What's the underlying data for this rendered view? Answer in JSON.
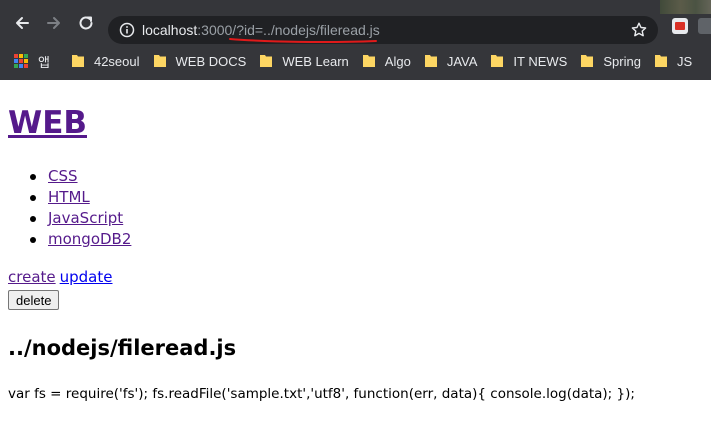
{
  "browser": {
    "url": {
      "host": "localhost",
      "rest": ":3000/?id=../nodejs/fileread.js"
    },
    "icons": {
      "back": "arrow-left-icon",
      "forward": "arrow-right-icon",
      "reload": "reload-icon",
      "site_info": "info-icon",
      "bookmark": "star-icon"
    },
    "bookmarks": [
      {
        "label": "앱",
        "icon": "apps-grid-icon"
      },
      {
        "label": "42seoul",
        "icon": "folder-icon"
      },
      {
        "label": "WEB DOCS",
        "icon": "folder-icon"
      },
      {
        "label": "WEB Learn",
        "icon": "folder-icon"
      },
      {
        "label": "Algo",
        "icon": "folder-icon"
      },
      {
        "label": "JAVA",
        "icon": "folder-icon"
      },
      {
        "label": "IT NEWS",
        "icon": "folder-icon"
      },
      {
        "label": "Spring",
        "icon": "folder-icon"
      },
      {
        "label": "JS",
        "icon": "folder-icon"
      }
    ]
  },
  "page": {
    "title": "WEB",
    "topics": [
      "CSS",
      "HTML",
      "JavaScript",
      "mongoDB2"
    ],
    "controls": {
      "create": "create",
      "update": "update",
      "delete": "delete"
    },
    "content": {
      "heading": "../nodejs/fileread.js",
      "body": "var fs = require('fs'); fs.readFile('sample.txt','utf8', function(err, data){ console.log(data); });"
    }
  },
  "colors": {
    "chrome_bg": "#35363a",
    "omnibox_bg": "#202124",
    "visited_link": "#551a8b",
    "link": "#0000ee",
    "annotation_red": "#e01a1a"
  }
}
